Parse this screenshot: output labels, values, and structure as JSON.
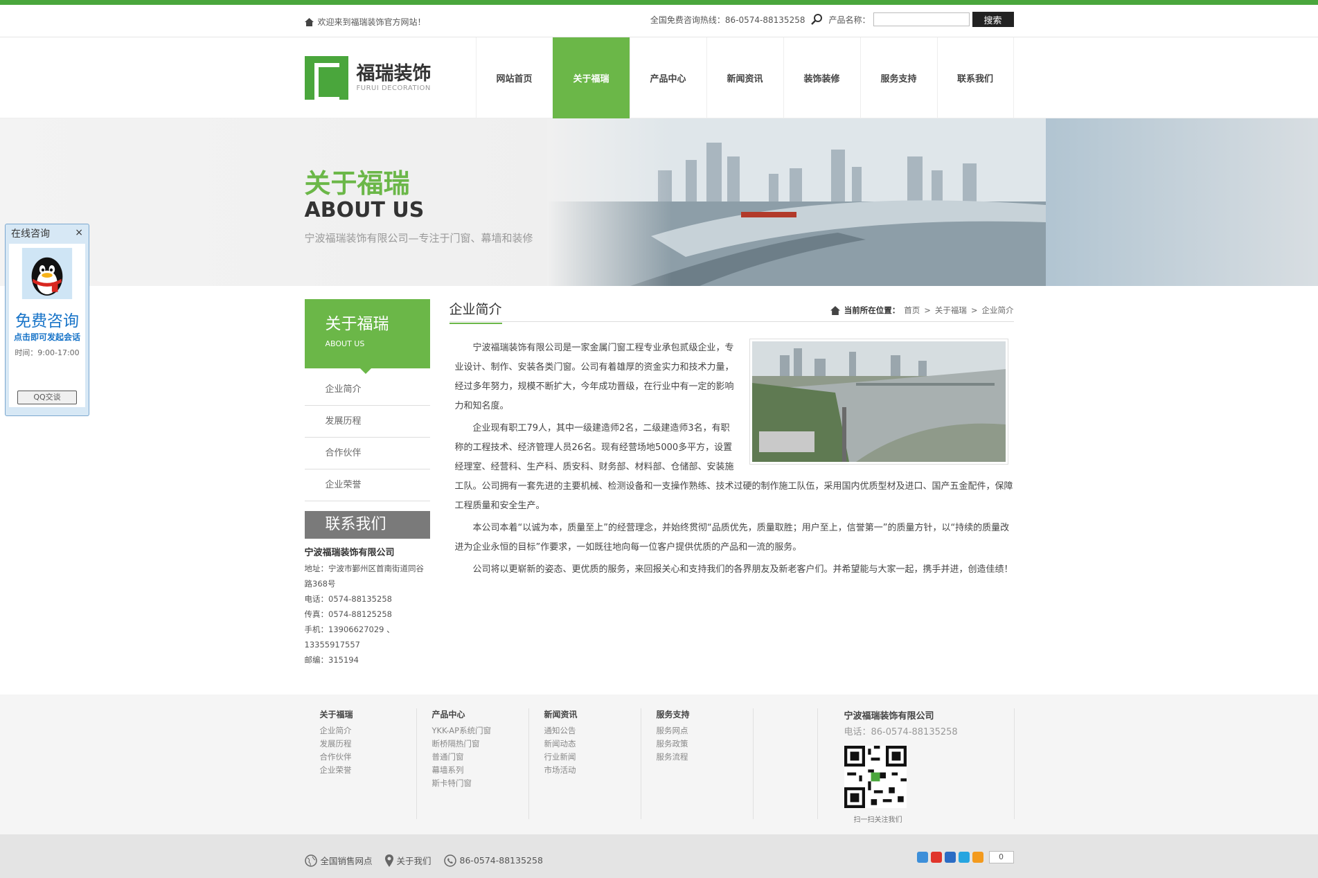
{
  "topbar": {
    "welcome": "欢迎来到福瑞装饰官方网站！",
    "hotline": "全国免费咨询热线：86-0574-88135258",
    "search_label": "产品名称：",
    "search_button": "搜索"
  },
  "logo": {
    "name": "福瑞装饰",
    "sub": "FURUI DECORATION"
  },
  "nav": [
    "网站首页",
    "关于福瑞",
    "产品中心",
    "新闻资讯",
    "装饰装修",
    "服务支持",
    "联系我们"
  ],
  "banner": {
    "title_cn": "关于福瑞",
    "title_en": "ABOUT US",
    "slogan": "宁波福瑞装饰有限公司—专注于门窗、幕墙和装修"
  },
  "sidebar": {
    "head_cn": "关于福瑞",
    "head_en": "ABOUT US",
    "items": [
      "企业简介",
      "发展历程",
      "合作伙伴",
      "企业荣誉"
    ],
    "contact_head": "联系我们",
    "company": "宁波福瑞装饰有限公司",
    "address": "地址：宁波市鄞州区首南街道同谷路368号",
    "phone": "电话：0574-88135258",
    "fax": "传真：0574-88125258",
    "mobile": "手机：13906627029 、13355917557",
    "postcode": "邮编：315194"
  },
  "article": {
    "title": "企业简介",
    "crumb_label": "当前所在位置：",
    "crumb_home": "首页",
    "crumb_sep": ">",
    "crumb_section": "关于福瑞",
    "crumb_page": "企业简介",
    "p1": "宁波福瑞装饰有限公司是一家金属门窗工程专业承包贰级企业，专业设计、制作、安装各类门窗。公司有着雄厚的资金实力和技术力量，经过多年努力，规模不断扩大，今年成功晋级，在行业中有一定的影响力和知名度。",
    "p2": "企业现有职工79人，其中一级建造师2名，二级建造师3名，有职称的工程技术、经济管理人员26名。现有经营场地5000多平方，设置经理室、经营科、生产科、质安科、财务部、材料部、仓储部、安装施工队。公司拥有一套先进的主要机械、检测设备和一支操作熟练、技术过硬的制作施工队伍，采用国内优质型材及进口、国产五金配件，保障工程质量和安全生产。",
    "p3": "本公司本着“以诚为本，质量至上”的经营理念，并始终贯彻“品质优先，质量取胜；用户至上，信誉第一”的质量方针，以“持续的质量改进为企业永恒的目标”作要求，一如既往地向每一位客户提供优质的产品和一流的服务。",
    "p4": "公司将以更崭新的姿态、更优质的服务，来回报关心和支持我们的各界朋友及新老客户们。并希望能与大家一起，携手并进，创造佳绩！"
  },
  "footer": {
    "cols": [
      {
        "head": "关于福瑞",
        "links": [
          "企业简介",
          "发展历程",
          "合作伙伴",
          "企业荣誉"
        ]
      },
      {
        "head": "产品中心",
        "links": [
          "YKK-AP系统门窗",
          "断桥隔热门窗",
          "普通门窗",
          "幕墙系列",
          "斯卡特门窗"
        ]
      },
      {
        "head": "新闻资讯",
        "links": [
          "通知公告",
          "新闻动态",
          "行业新闻",
          "市场活动"
        ]
      },
      {
        "head": "服务支持",
        "links": [
          "服务网点",
          "服务政策",
          "服务流程"
        ]
      }
    ],
    "company": "宁波福瑞装饰有限公司",
    "tel": "电话：86-0574-88135258",
    "qr_caption": "扫一扫关注我们"
  },
  "bottom": {
    "sales": "全国销售网点",
    "about": "关于我们",
    "phone": "86-0574-88135258",
    "share_count": "0"
  },
  "qq": {
    "head": "在线咨询",
    "close": "×",
    "free": "免费咨询",
    "click": "点击即可发起会话",
    "time": "时间：9:00-17:00",
    "button": "QQ交谈"
  },
  "colors": {
    "brand_green": "#6bb748",
    "top_green": "#4aa63c",
    "qq_blue": "#1874c8"
  }
}
